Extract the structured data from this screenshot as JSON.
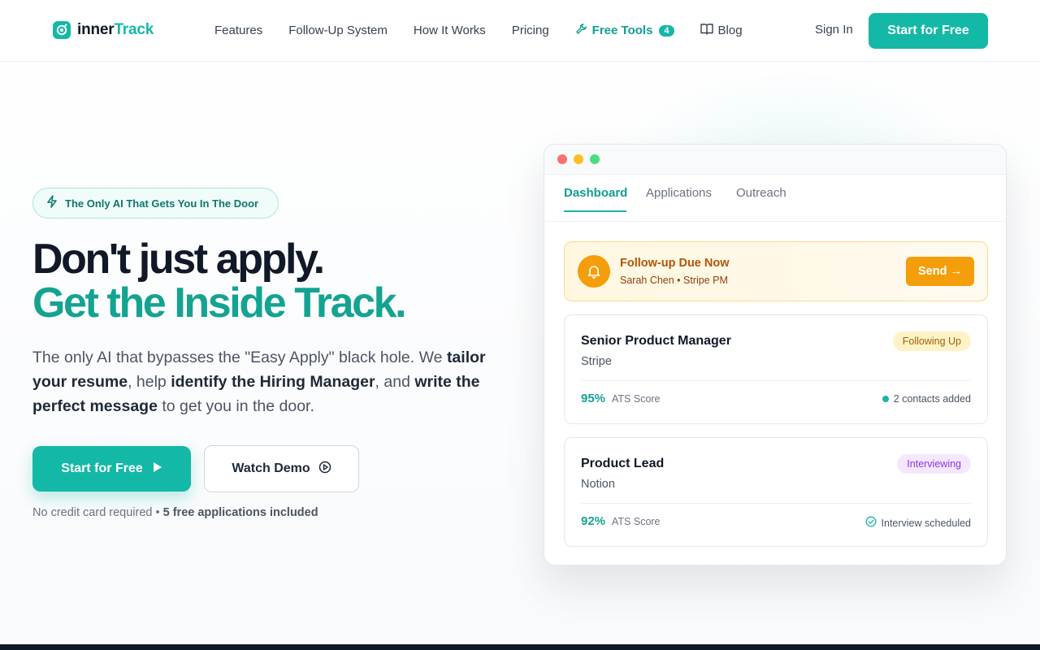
{
  "nav": {
    "logo_prefix": "inner",
    "logo_accent": "Track",
    "links": [
      "Features",
      "Follow-Up System",
      "How It Works",
      "Pricing"
    ],
    "free_tools_label": "Free Tools",
    "free_tools_count": "4",
    "blog_label": "Blog",
    "sign_in": "Sign In",
    "cta": "Start for Free"
  },
  "hero": {
    "pill": "The Only AI That Gets You In The Door",
    "headline_1": "Don't just apply.",
    "headline_2": "Get the Inside Track.",
    "lead": {
      "p1": "The only AI that bypasses the \"Easy Apply\" black hole. We ",
      "b1": "tailor your resume",
      "p2": ", help ",
      "b2": "identify the Hiring Manager",
      "p3": ", and ",
      "b3": "write the perfect message",
      "p4": " to get you in the door."
    },
    "primary_cta": "Start for Free",
    "secondary_cta": "Watch Demo",
    "fineprint_1": "No credit card required • ",
    "fineprint_2": "5 free applications included"
  },
  "dashboard": {
    "tabs": [
      "Dashboard",
      "Applications",
      "Outreach"
    ],
    "active_tab": "Dashboard",
    "alert": {
      "title": "Follow-up Due Now",
      "subtitle": "Sarah Chen • Stripe PM",
      "button": "Send →"
    },
    "jobs": [
      {
        "title": "Senior Product Manager",
        "company": "Stripe",
        "status": "Following Up",
        "score": "95%",
        "score_label": "ATS Score",
        "meta": "2 contacts added"
      },
      {
        "title": "Product Lead",
        "company": "Notion",
        "status": "Interviewing",
        "score": "92%",
        "score_label": "ATS Score",
        "meta": "Interview scheduled"
      }
    ]
  },
  "colors": {
    "brand": "#14b8a6",
    "heading": "#111827",
    "warning": "#f59e0b",
    "purple": "#9333ea"
  },
  "icons": [
    "logo-icon",
    "wrench-icon",
    "book-icon",
    "lightning-icon",
    "play-icon",
    "play-circle-icon",
    "bell-icon",
    "check-circle-icon"
  ]
}
